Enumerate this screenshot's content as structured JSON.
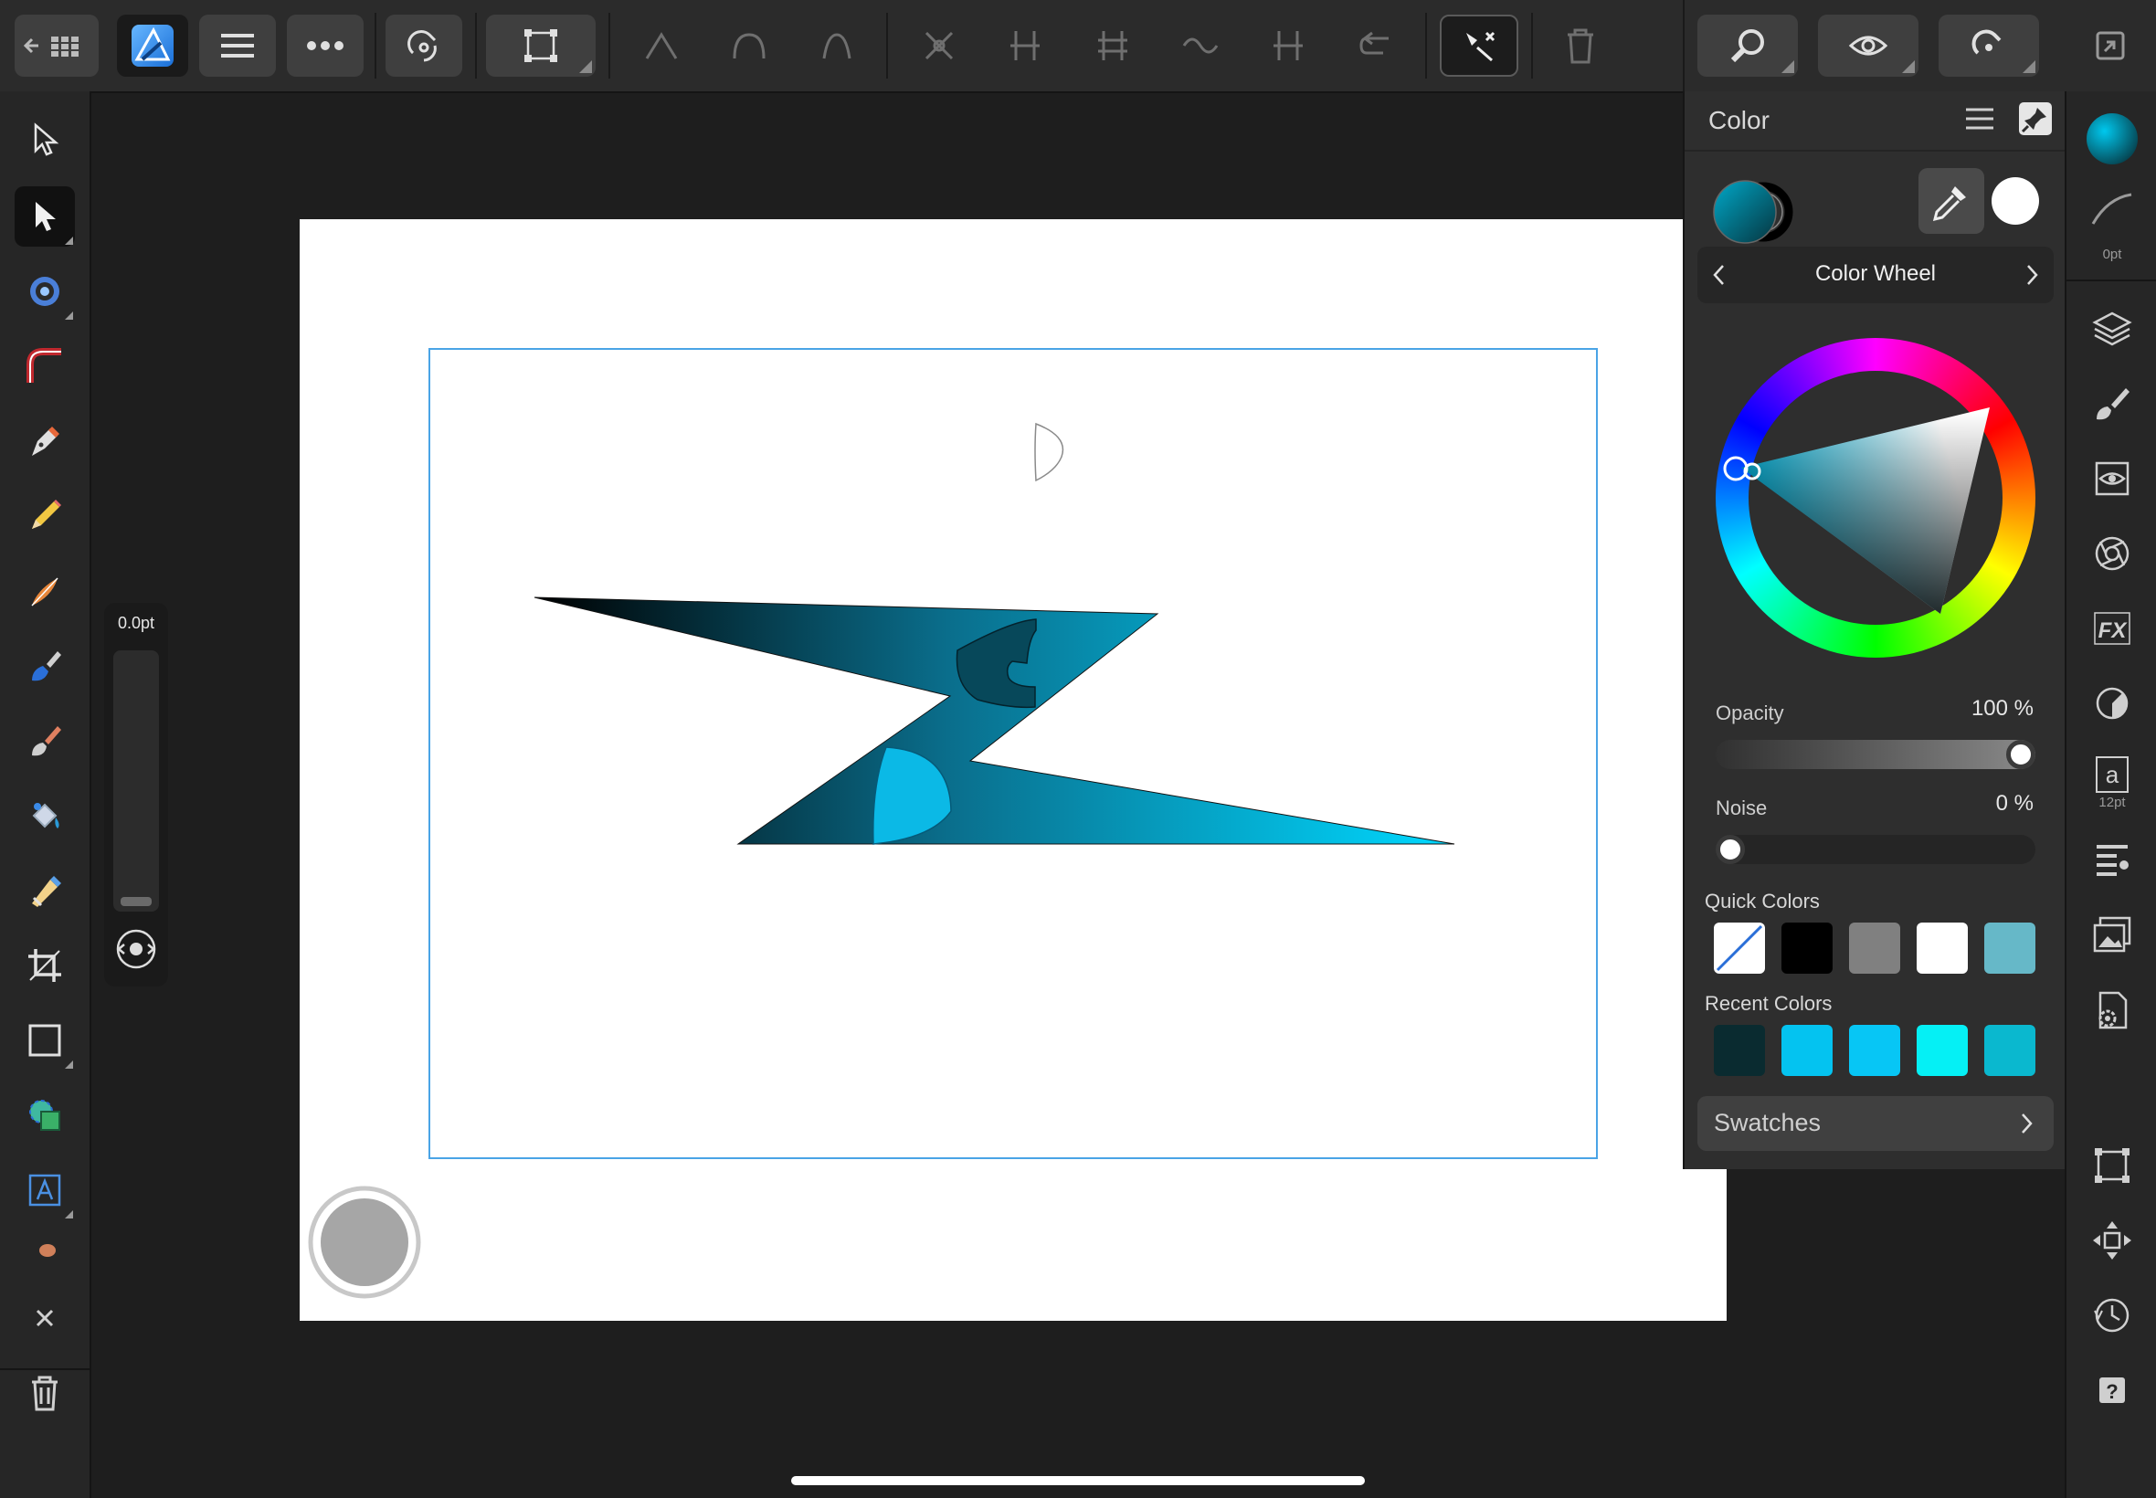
{
  "app": {
    "name": "Affinity Designer"
  },
  "width_panel": {
    "value": "0.0pt"
  },
  "color_panel": {
    "title": "Color",
    "mode_label": "Color Wheel",
    "opacity_label": "Opacity",
    "opacity_value": "100 %",
    "opacity_fraction": 1.0,
    "noise_label": "Noise",
    "noise_value": "0 %",
    "noise_fraction": 0.0,
    "quick_colors_label": "Quick Colors",
    "quick_colors": [
      "none",
      "#000000",
      "#808080",
      "#ffffff",
      "#66b8c8"
    ],
    "recent_colors_label": "Recent Colors",
    "recent_colors": [
      "#0a2b30",
      "#04c3f0",
      "#07c6f5",
      "#05f0f5",
      "#0ab8cf"
    ],
    "swatches_label": "Swatches"
  },
  "studio": {
    "stroke_width": "0pt",
    "text_size": "12pt"
  },
  "colors": {
    "accent": "#4aa4e6",
    "fill_gradient_start": "#000000",
    "fill_gradient_end": "#00d8ff"
  }
}
